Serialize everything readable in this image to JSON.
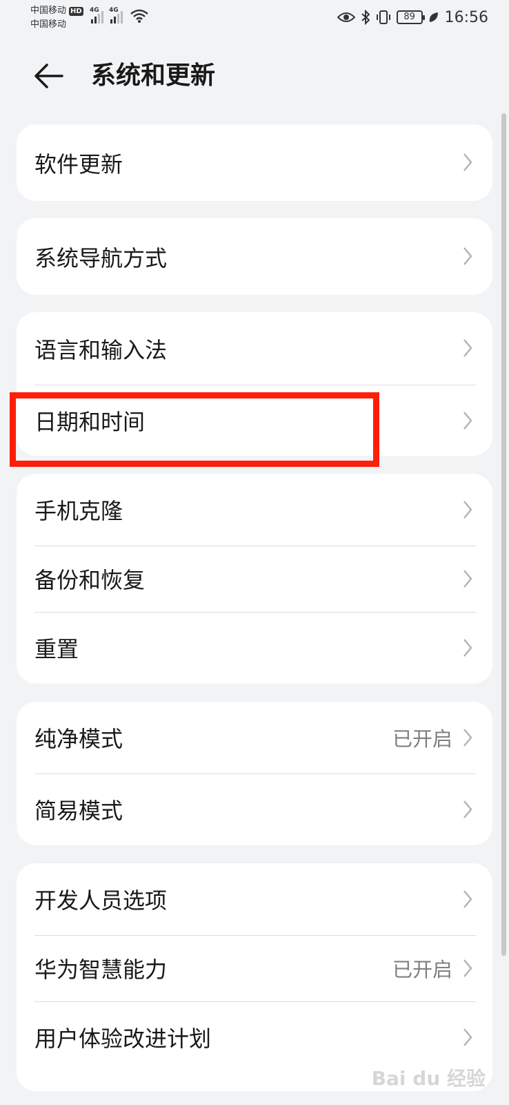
{
  "status_bar": {
    "carrier_1": "中国移动",
    "carrier_1_badge": "HD",
    "carrier_2": "中国移动",
    "signal_1_tag": "4G",
    "signal_2_tag": "4G",
    "battery_level": "89",
    "time": "16:56"
  },
  "header": {
    "title": "系统和更新"
  },
  "groups": [
    {
      "items": [
        {
          "label": "软件更新"
        }
      ]
    },
    {
      "items": [
        {
          "label": "系统导航方式"
        }
      ]
    },
    {
      "items": [
        {
          "label": "语言和输入法"
        },
        {
          "label": "日期和时间"
        }
      ]
    },
    {
      "items": [
        {
          "label": "手机克隆"
        },
        {
          "label": "备份和恢复"
        },
        {
          "label": "重置"
        }
      ]
    },
    {
      "items": [
        {
          "label": "纯净模式",
          "value": "已开启"
        },
        {
          "label": "简易模式"
        }
      ]
    },
    {
      "items": [
        {
          "label": "开发人员选项"
        },
        {
          "label": "华为智慧能力",
          "value": "已开启"
        },
        {
          "label": "用户体验改进计划"
        }
      ]
    }
  ],
  "watermark": "Bai du 经验",
  "colors": {
    "background": "#f1f3f5",
    "card": "#ffffff",
    "highlight": "#ff1e0a",
    "secondary_text": "#808080"
  }
}
